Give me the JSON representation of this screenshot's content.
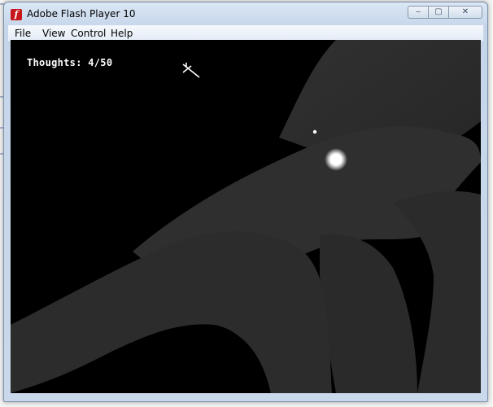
{
  "window": {
    "title": "Adobe Flash Player 10",
    "app_icon_glyph": "f",
    "controls": {
      "minimize": "‒",
      "maximize": "▢",
      "close": "✕"
    }
  },
  "menu": {
    "items": [
      {
        "label": "File"
      },
      {
        "label": "View"
      },
      {
        "label": "Control"
      },
      {
        "label": "Help"
      }
    ]
  },
  "game": {
    "hud": {
      "thoughts_label": "Thoughts: 4/50",
      "thoughts_current": 4,
      "thoughts_total": 50
    },
    "colors": {
      "background": "#000000",
      "branches": "#2e2e2e",
      "branches_dim": "#232323",
      "glow": "#ffffff"
    }
  }
}
